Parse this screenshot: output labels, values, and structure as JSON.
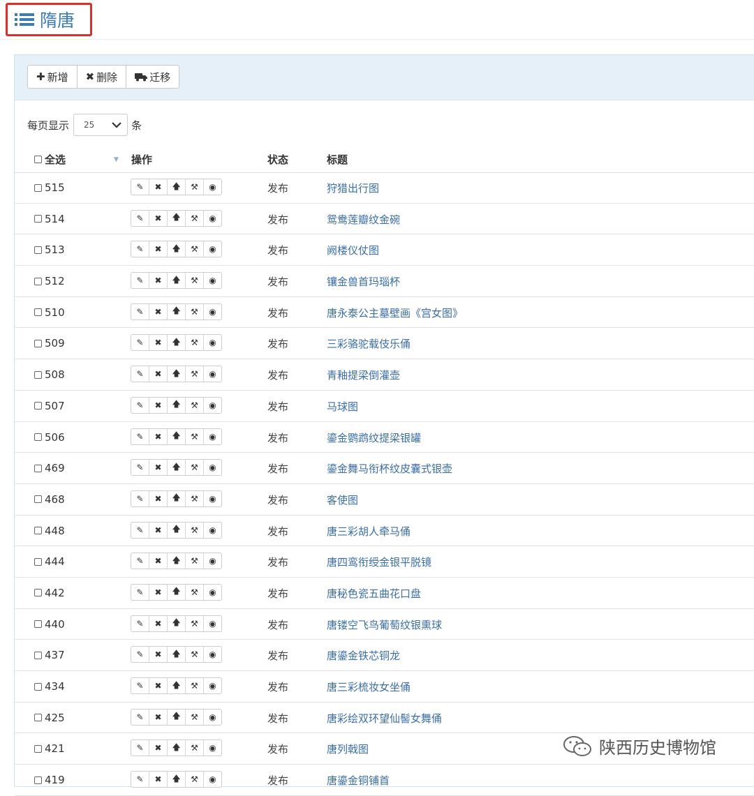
{
  "header": {
    "title": "隋唐"
  },
  "toolbar": {
    "add_label": "新增",
    "delete_label": "删除",
    "migrate_label": "迁移"
  },
  "pagesize": {
    "prefix": "每页显示",
    "value": "25",
    "suffix": "条"
  },
  "table": {
    "headers": {
      "select_all": "全选",
      "actions": "操作",
      "status": "状态",
      "title": "标题"
    },
    "rows": [
      {
        "id": "515",
        "status": "发布",
        "title": "狩猎出行图"
      },
      {
        "id": "514",
        "status": "发布",
        "title": "鸳鸯莲瓣纹金碗"
      },
      {
        "id": "513",
        "status": "发布",
        "title": "阙楼仪仗图"
      },
      {
        "id": "512",
        "status": "发布",
        "title": "镶金兽首玛瑙杯"
      },
      {
        "id": "510",
        "status": "发布",
        "title": "唐永泰公主墓壁画《宫女图》"
      },
      {
        "id": "509",
        "status": "发布",
        "title": "三彩骆驼载伎乐俑"
      },
      {
        "id": "508",
        "status": "发布",
        "title": "青釉提梁倒灌壶"
      },
      {
        "id": "507",
        "status": "发布",
        "title": "马球图"
      },
      {
        "id": "506",
        "status": "发布",
        "title": "鎏金鹦鹉纹提梁银罐"
      },
      {
        "id": "469",
        "status": "发布",
        "title": "鎏金舞马衔杯纹皮囊式银壶"
      },
      {
        "id": "468",
        "status": "发布",
        "title": "客使图"
      },
      {
        "id": "448",
        "status": "发布",
        "title": "唐三彩胡人牵马俑"
      },
      {
        "id": "444",
        "status": "发布",
        "title": "唐四鸾衔绶金银平脱镜"
      },
      {
        "id": "442",
        "status": "发布",
        "title": "唐秘色瓷五曲花口盘"
      },
      {
        "id": "440",
        "status": "发布",
        "title": "唐镂空飞鸟葡萄纹银熏球"
      },
      {
        "id": "437",
        "status": "发布",
        "title": "唐鎏金铁芯铜龙"
      },
      {
        "id": "434",
        "status": "发布",
        "title": "唐三彩梳妆女坐俑"
      },
      {
        "id": "425",
        "status": "发布",
        "title": "唐彩绘双环望仙髻女舞俑"
      },
      {
        "id": "421",
        "status": "发布",
        "title": "唐列戟图"
      },
      {
        "id": "419",
        "status": "发布",
        "title": "唐鎏金铜铺首"
      }
    ]
  },
  "watermark": {
    "text": "陕西历史博物馆"
  },
  "colors": {
    "accent": "#3a7bb8",
    "highlight_border": "#d9302b",
    "panel_header": "#e5f0f8",
    "link": "#3a6ea5"
  },
  "icons": {
    "title": "list-icon",
    "add": "plus-icon",
    "delete": "times-icon",
    "migrate": "truck-icon",
    "row_actions": [
      "edit-icon",
      "delete-icon",
      "arrow-up-icon",
      "gavel-icon",
      "eye-icon"
    ]
  }
}
